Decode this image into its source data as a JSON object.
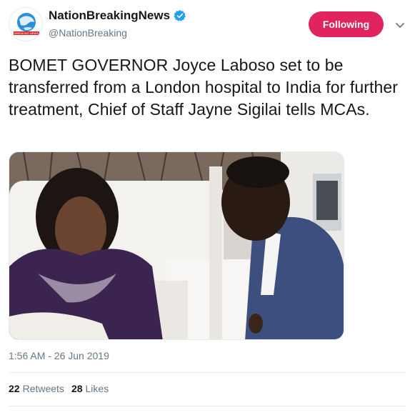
{
  "account": {
    "display_name": "NationBreakingNews",
    "handle": "@NationBreaking",
    "verified": true,
    "logo_text": "BREAKING NEWS"
  },
  "follow_button": {
    "label": "Following",
    "color": "#e0245e"
  },
  "tweet": {
    "text": "BOMET GOVERNOR Joyce Laboso set to be transferred from a London hospital to India for further treatment, Chief of Staff Jayne Sigilai tells MCAs.",
    "timestamp": "1:56 AM - 26 Jun 2019",
    "media_description": "photo-hospital-visit"
  },
  "stats": {
    "retweets_count": "22",
    "retweets_label": "Retweets",
    "likes_count": "28",
    "likes_label": "Likes"
  },
  "colors": {
    "accent": "#1da1f2",
    "text": "#14171a",
    "muted": "#657786"
  }
}
